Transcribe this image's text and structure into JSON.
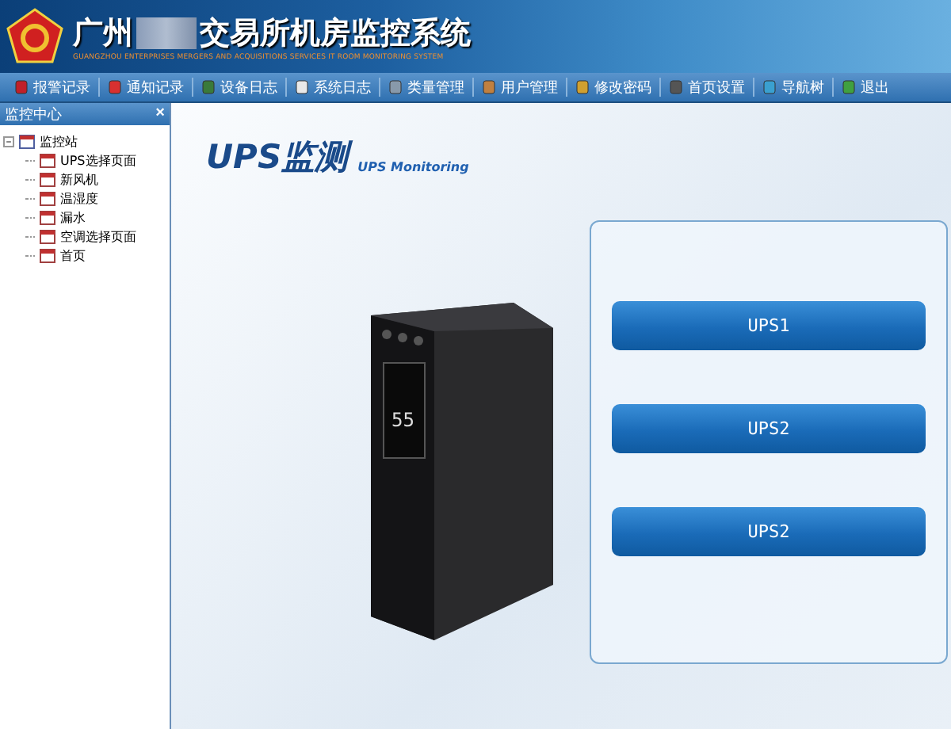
{
  "header": {
    "title_start": "广州",
    "title_end": "交易所机房监控系统",
    "subtitle": "GUANGZHOU ENTERPRISES MERGERS AND ACQUISITIONS SERVICES IT ROOM MONITORING SYSTEM"
  },
  "toolbar": [
    {
      "label": "报警记录",
      "kind": "alarm"
    },
    {
      "label": "通知记录",
      "kind": "notice"
    },
    {
      "label": "设备日志",
      "kind": "device"
    },
    {
      "label": "系统日志",
      "kind": "syslog"
    },
    {
      "label": "类量管理",
      "kind": "quantity"
    },
    {
      "label": "用户管理",
      "kind": "user"
    },
    {
      "label": "修改密码",
      "kind": "lock"
    },
    {
      "label": "首页设置",
      "kind": "tools"
    },
    {
      "label": "导航树",
      "kind": "tree"
    },
    {
      "label": "退出",
      "kind": "exit"
    }
  ],
  "sidebar": {
    "title": "监控中心",
    "close": "×",
    "tree": [
      {
        "label": "监控站",
        "expanded": true,
        "children": [
          {
            "label": "UPS选择页面"
          },
          {
            "label": "新风机"
          },
          {
            "label": "温湿度"
          },
          {
            "label": "漏水"
          },
          {
            "label": "空调选择页面"
          },
          {
            "label": "首页"
          }
        ]
      }
    ]
  },
  "main": {
    "title": "UPS监测",
    "subtitle": "UPS Monitoring",
    "device_display": "55",
    "buttons": [
      "UPS1",
      "UPS2",
      "UPS2"
    ]
  }
}
